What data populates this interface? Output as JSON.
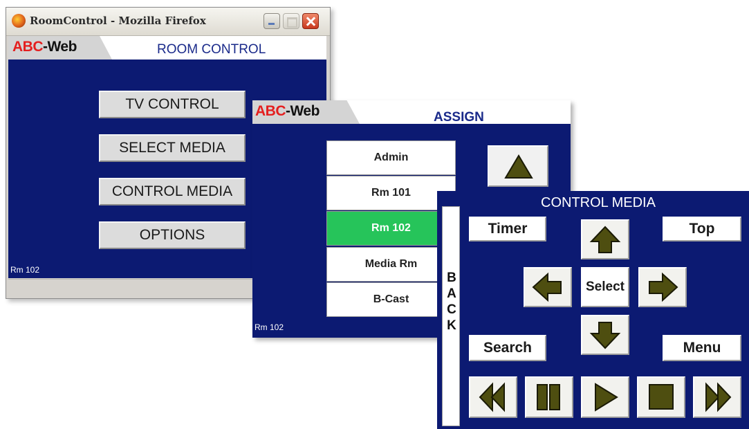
{
  "window1": {
    "title": "RoomControl - Mozilla Firefox",
    "logo": {
      "red": "ABC",
      "black": "-Web"
    },
    "heading": "ROOM CONTROL",
    "buttons": [
      "TV CONTROL",
      "SELECT MEDIA",
      "CONTROL MEDIA",
      "OPTIONS"
    ],
    "room_label": "Rm 102"
  },
  "window2": {
    "logo": {
      "red": "ABC",
      "black": "-Web"
    },
    "heading": "ASSIGN",
    "rooms": [
      "Admin",
      "Rm 101",
      "Rm 102",
      "Media Rm",
      "B-Cast"
    ],
    "selected_room": "Rm 102",
    "room_label": "Rm 102",
    "scroll_up_icon": "up-triangle-icon"
  },
  "window3": {
    "heading": "CONTROL MEDIA",
    "back_letters": [
      "B",
      "A",
      "C",
      "K"
    ],
    "buttons": {
      "timer": "Timer",
      "top": "Top",
      "select": "Select",
      "search": "Search",
      "menu": "Menu"
    },
    "transport_icons": [
      "rewind-icon",
      "pause-icon",
      "play-icon",
      "stop-icon",
      "fast-forward-icon"
    ],
    "arrow_icons": [
      "up-arrow-icon",
      "left-arrow-icon",
      "right-arrow-icon",
      "down-arrow-icon"
    ]
  },
  "colors": {
    "panel_blue": "#0c1a72",
    "heading_blue": "#1a2a8a",
    "logo_red": "#e41f1f",
    "selected_green": "#26c45a",
    "icon_olive": "#4e4e10"
  }
}
